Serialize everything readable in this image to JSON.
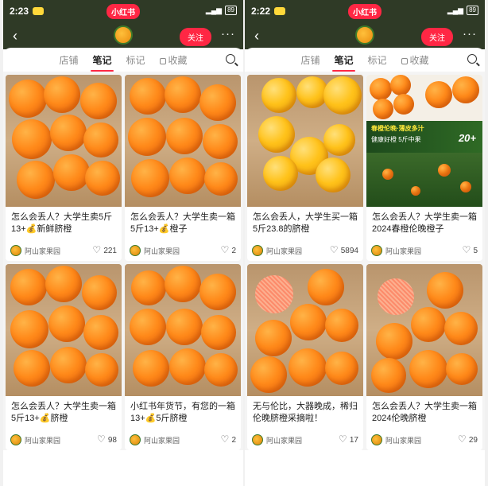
{
  "screens": [
    {
      "status": {
        "time": "2:23",
        "app_badge": "小红书",
        "battery": "89"
      },
      "nav": {
        "back_icon": "chevron-left-icon",
        "follow_label": "关注",
        "more_label": "···"
      },
      "tabs": [
        "店铺",
        "笔记",
        "标记",
        "收藏"
      ],
      "active_tab": 1,
      "notes": [
        {
          "title": "怎么会丢人？大学生卖5斤13+💰新鲜脐橙",
          "author": "阿山家果园",
          "likes": "221"
        },
        {
          "title": "怎么会丢人？大学生卖一箱5斤13+💰橙子",
          "author": "阿山家果园",
          "likes": "2"
        },
        {
          "title": "怎么会丢人？大学生卖一箱5斤13+💰脐橙",
          "author": "阿山家果园",
          "likes": "98"
        },
        {
          "title": "小红书年货节，有您的一箱13+💰5斤脐橙",
          "author": "阿山家果园",
          "likes": "2"
        }
      ]
    },
    {
      "status": {
        "time": "2:22",
        "app_badge": "小红书",
        "battery": "89"
      },
      "nav": {
        "back_icon": "chevron-left-icon",
        "follow_label": "关注",
        "more_label": "···"
      },
      "tabs": [
        "店铺",
        "笔记",
        "标记",
        "收藏"
      ],
      "active_tab": 1,
      "banner": {
        "line1": "春橙伦晚·薄皮多汁",
        "line2": "健康好橙 5斤中果",
        "big": "20+"
      },
      "notes": [
        {
          "title": "怎么会丢人，大学生买一箱5斤23.8的脐橙",
          "author": "阿山家果园",
          "likes": "5894"
        },
        {
          "title": "怎么会丢人？大学生卖一箱2024春橙伦晚橙子",
          "author": "阿山家果园",
          "likes": "5"
        },
        {
          "title": "无与伦比，大器晚成，稀归伦晚脐橙采摘啦！",
          "author": "阿山家果园",
          "likes": "17"
        },
        {
          "title": "怎么会丢人？大学生卖一箱2024伦晚脐橙",
          "author": "阿山家果园",
          "likes": "29"
        }
      ]
    }
  ],
  "colors": {
    "header_bg": "#2f3a26",
    "accent": "#ff2744"
  }
}
